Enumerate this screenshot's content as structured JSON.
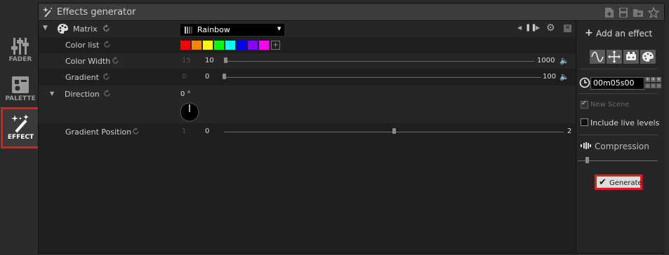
{
  "sidebar": {
    "items": [
      {
        "label": "FADER",
        "icon": "fader-icon"
      },
      {
        "label": "PALETTE",
        "icon": "palette-icon"
      },
      {
        "label": "EFFECT",
        "icon": "magic-wand-icon",
        "active": true
      }
    ]
  },
  "window": {
    "title": "Effects generator",
    "toolbar_icons": [
      "new-file-icon",
      "save-icon",
      "open-folder-icon",
      "star-icon"
    ]
  },
  "effect": {
    "name": "Matrix",
    "preset": "Rainbow",
    "params": {
      "color_list": {
        "label": "Color list",
        "colors": [
          "#ff0000",
          "#ff8800",
          "#ffff00",
          "#00ff00",
          "#00ffff",
          "#0000ff",
          "#8800ff",
          "#ff00ff"
        ]
      },
      "color_width": {
        "label": "Color Width",
        "default": "15",
        "min": "10",
        "max": "1000",
        "value_fraction": 0.0
      },
      "gradient": {
        "label": "Gradient",
        "default": "0",
        "min": "0",
        "max": "100",
        "value_fraction": 0.0
      },
      "direction": {
        "label": "Direction",
        "value": "0 °"
      },
      "gradient_position": {
        "label": "Gradient Position",
        "default": "1",
        "min": "0",
        "max": "2",
        "value_fraction": 0.5
      }
    }
  },
  "right_panel": {
    "add_effect": "Add an effect",
    "effect_type_icons": [
      "sine-wave-icon",
      "move-cross-icon",
      "pixel-map-icon",
      "color-palette-icon"
    ],
    "duration": "00m05s00",
    "new_scene_label": "New Scene",
    "new_scene_checked": true,
    "include_live_label": "Include live levels",
    "include_live_checked": false,
    "compression_label": "Compression",
    "compression_fraction": 0.1,
    "generate_label": "Generate"
  },
  "colors": {
    "accent_red": "#e01b24",
    "panel_bg": "#1f1f1f"
  }
}
